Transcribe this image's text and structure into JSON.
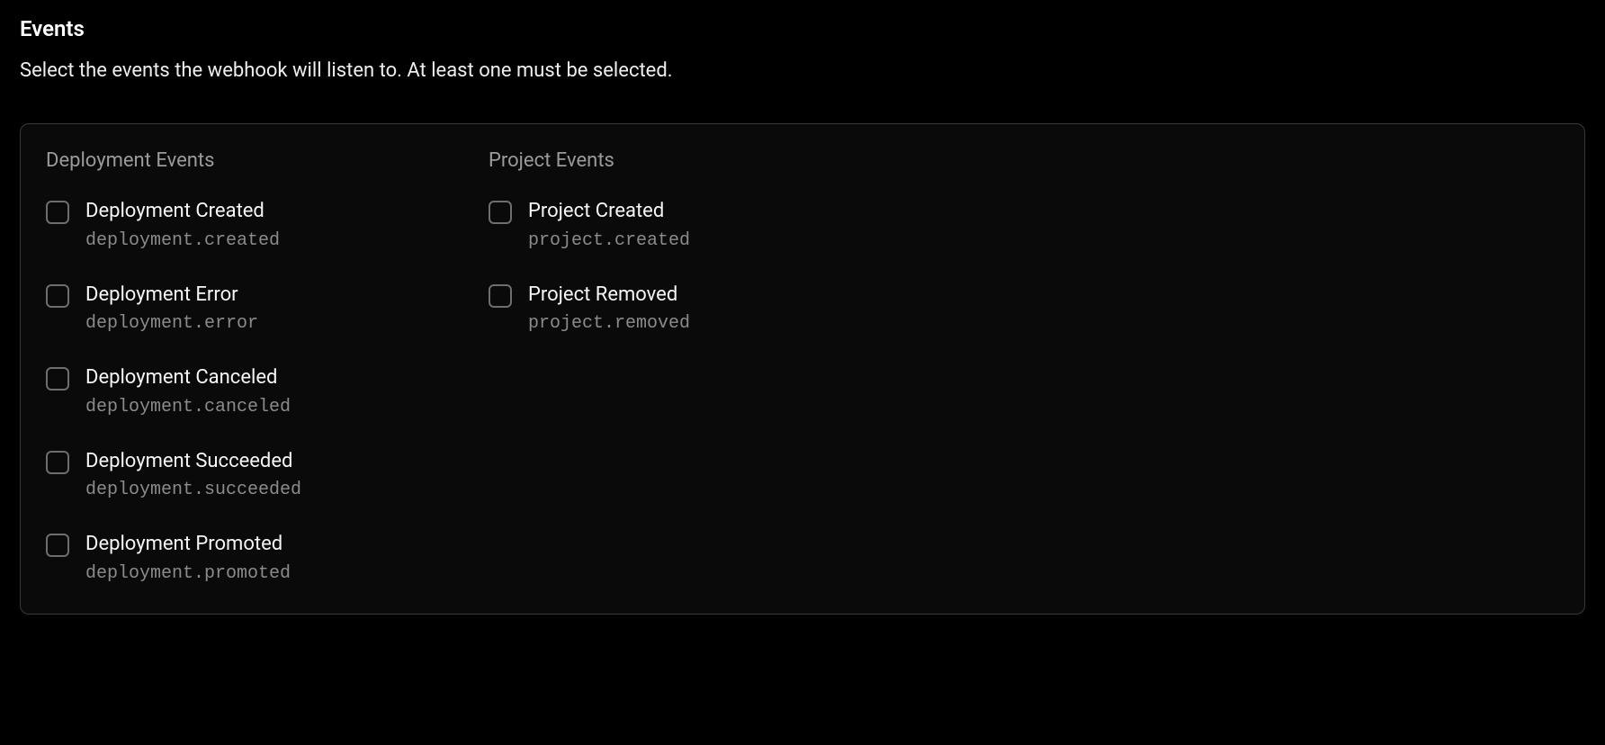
{
  "header": {
    "title": "Events",
    "subtitle": "Select the events the webhook will listen to. At least one must be selected."
  },
  "groups": [
    {
      "heading": "Deployment Events",
      "class": "deployment",
      "items": [
        {
          "label": "Deployment Created",
          "slug": "deployment.created"
        },
        {
          "label": "Deployment Error",
          "slug": "deployment.error"
        },
        {
          "label": "Deployment Canceled",
          "slug": "deployment.canceled"
        },
        {
          "label": "Deployment Succeeded",
          "slug": "deployment.succeeded"
        },
        {
          "label": "Deployment Promoted",
          "slug": "deployment.promoted"
        }
      ]
    },
    {
      "heading": "Project Events",
      "class": "project",
      "items": [
        {
          "label": "Project Created",
          "slug": "project.created"
        },
        {
          "label": "Project Removed",
          "slug": "project.removed"
        }
      ]
    }
  ]
}
